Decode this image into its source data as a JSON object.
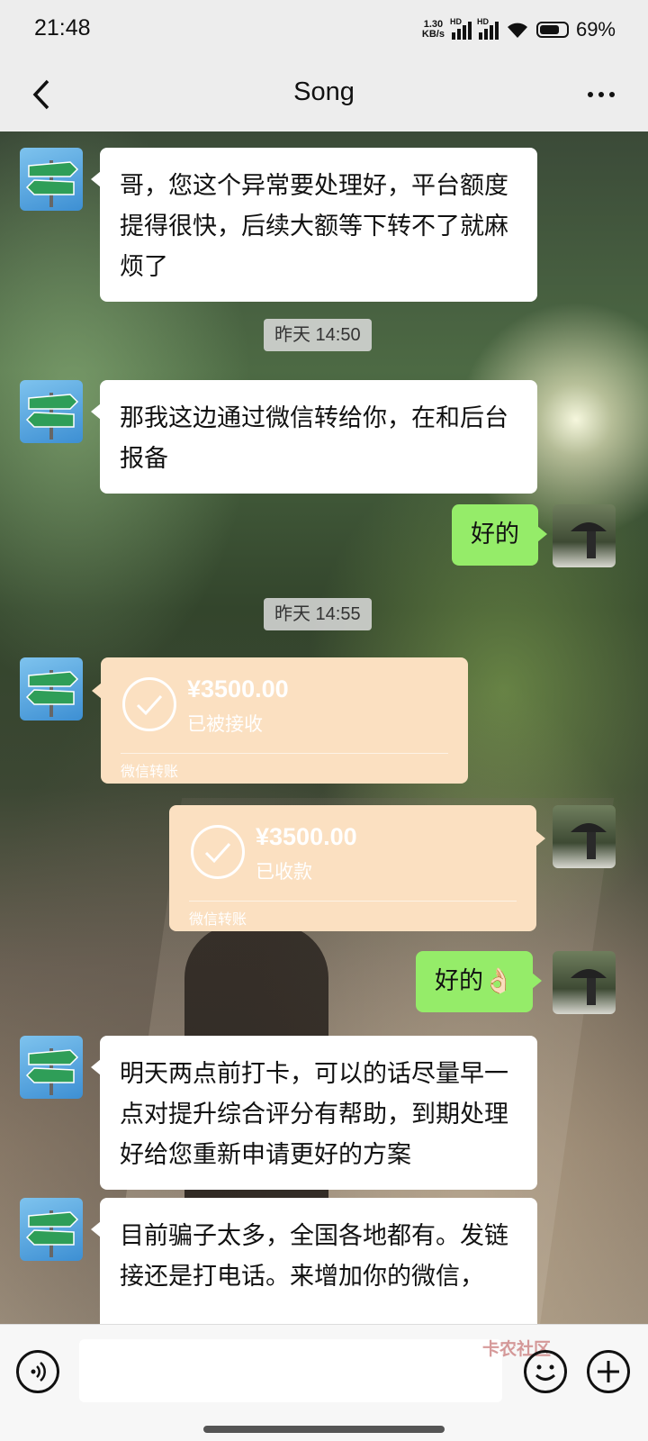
{
  "status_bar": {
    "time": "21:48",
    "net_speed": "1.30",
    "net_unit": "KB/s",
    "hd1": "HD",
    "hd2": "HD",
    "battery": "69%"
  },
  "header": {
    "title": "Song"
  },
  "messages": [
    {
      "side": "left",
      "text": "哥，您这个异常要处理好，平台额度提得很快，后续大额等下转不了就麻烦了"
    },
    {
      "type": "timestamp",
      "text": "昨天 14:50"
    },
    {
      "side": "left",
      "text": "那我这边通过微信转给你，在和后台报备"
    },
    {
      "side": "right",
      "text": "好的"
    },
    {
      "type": "timestamp",
      "text": "昨天 14:55"
    },
    {
      "side": "left",
      "type": "transfer",
      "amount": "¥3500.00",
      "state": "已被接收",
      "kind": "微信转账"
    },
    {
      "side": "right",
      "type": "transfer",
      "amount": "¥3500.00",
      "state": "已收款",
      "kind": "微信转账"
    },
    {
      "side": "right",
      "text": "好的👌🏻"
    },
    {
      "side": "left",
      "text": "明天两点前打卡，可以的话尽量早一点对提升综合评分有帮助，到期处理好给您重新申请更好的方案"
    },
    {
      "side": "left",
      "text": "目前骗子太多，全国各地都有。发链接还是打电话。来增加你的微信，"
    }
  ],
  "input_bar": {
    "watermark": "卡农社区"
  },
  "colors": {
    "bubble_right": "#95ec69",
    "transfer": "#fbe0c1",
    "header_bg": "#ededed"
  }
}
